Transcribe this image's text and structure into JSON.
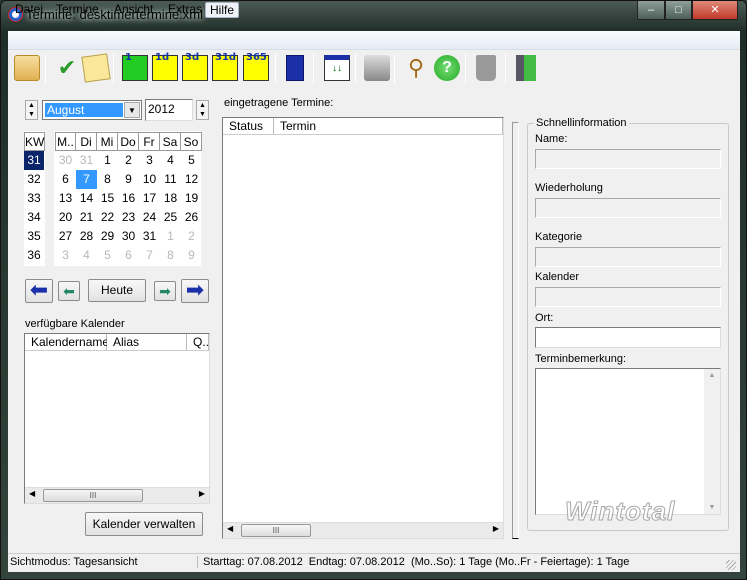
{
  "window": {
    "title": "Termine: desktimertermine.xml",
    "minimize": "–",
    "maximize": "□",
    "close": "✕"
  },
  "menu": [
    "Datei",
    "Termine",
    "Ansicht",
    "Extras",
    "Hilfe"
  ],
  "toolbar": {
    "day1": "1",
    "d1": "1d",
    "d3": "3d",
    "d31": "31d",
    "d365": "365"
  },
  "calendar": {
    "month": "August",
    "year": "2012",
    "kw_label": "KW",
    "weekdays": [
      "M..",
      "Di",
      "Mi",
      "Do",
      "Fr",
      "Sa",
      "So"
    ],
    "weeks": [
      "31",
      "32",
      "33",
      "34",
      "35",
      "36"
    ],
    "days": [
      [
        "30",
        "31",
        "1",
        "2",
        "3",
        "4",
        "5"
      ],
      [
        "6",
        "7",
        "8",
        "9",
        "10",
        "11",
        "12"
      ],
      [
        "13",
        "14",
        "15",
        "16",
        "17",
        "18",
        "19"
      ],
      [
        "20",
        "21",
        "22",
        "23",
        "24",
        "25",
        "26"
      ],
      [
        "27",
        "28",
        "29",
        "30",
        "31",
        "1",
        "2"
      ],
      [
        "3",
        "4",
        "5",
        "6",
        "7",
        "8",
        "9"
      ]
    ],
    "selected_week": "31",
    "selected_day": "7",
    "today_label": "Heute"
  },
  "calendars": {
    "label": "verfügbare Kalender",
    "columns": [
      "Kalendername",
      "Alias",
      "Q..."
    ],
    "manage_button": "Kalender verwalten"
  },
  "appointments": {
    "label": "eingetragene Termine:",
    "columns": [
      "Status",
      "Termin"
    ]
  },
  "quickinfo": {
    "title": "Schnellinformation",
    "name": "Name:",
    "repeat": "Wiederholung",
    "category": "Kategorie",
    "calendar": "Kalender",
    "location": "Ort:",
    "note": "Terminbemerkung:"
  },
  "watermark": "Wintotal",
  "status": {
    "mode": "Sichtmodus: Tagesansicht",
    "range": "Starttag: 07.08.2012  Endtag: 07.08.2012  (Mo..So): 1 Tage (Mo..Fr - Feiertage): 1 Tage"
  }
}
